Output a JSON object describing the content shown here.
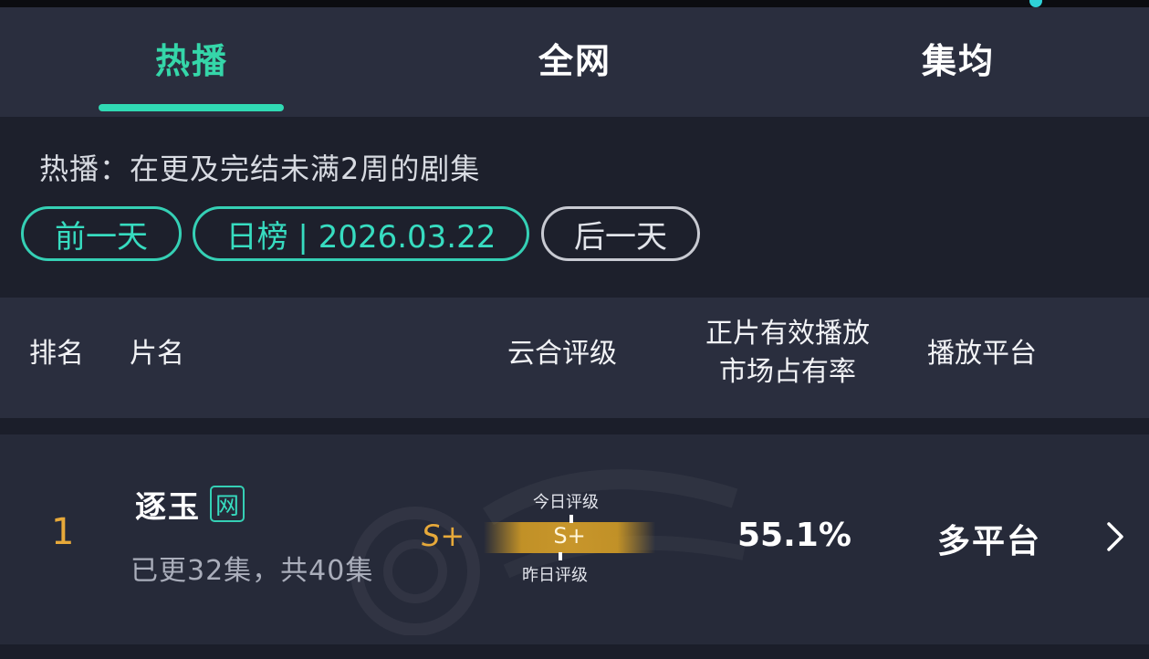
{
  "tabs": [
    {
      "label": "热播",
      "active": true
    },
    {
      "label": "全网",
      "active": false
    },
    {
      "label": "集均",
      "active": false
    }
  ],
  "filter": {
    "description": "热播：在更及完结未满2周的剧集",
    "prev_label": "前一天",
    "current_label": "日榜 | 2026.03.22",
    "next_label": "后一天"
  },
  "table": {
    "headers": {
      "rank": "排名",
      "title": "片名",
      "grade": "云合评级",
      "share_line1": "正片有效播放",
      "share_line2": "市场占有率",
      "platform": "播放平台"
    },
    "rows": [
      {
        "rank": "1",
        "title": "逐玉",
        "badge": "网",
        "episodes": "已更32集，共40集",
        "grade": "S+",
        "grade_today_label": "今日评级",
        "grade_bar": "S+",
        "grade_yesterday_label": "昨日评级",
        "share": "55.1%",
        "platform": "多平台"
      }
    ]
  },
  "colors": {
    "accent": "#35d6a9",
    "rank": "#e7a93a",
    "grade_gold": "#c8962b",
    "background": "#1b1e2a",
    "panel": "#2a2e3e"
  },
  "icons": {
    "row_chevron": "chevron-right-icon",
    "watermark": "watermark-logo-icon"
  }
}
